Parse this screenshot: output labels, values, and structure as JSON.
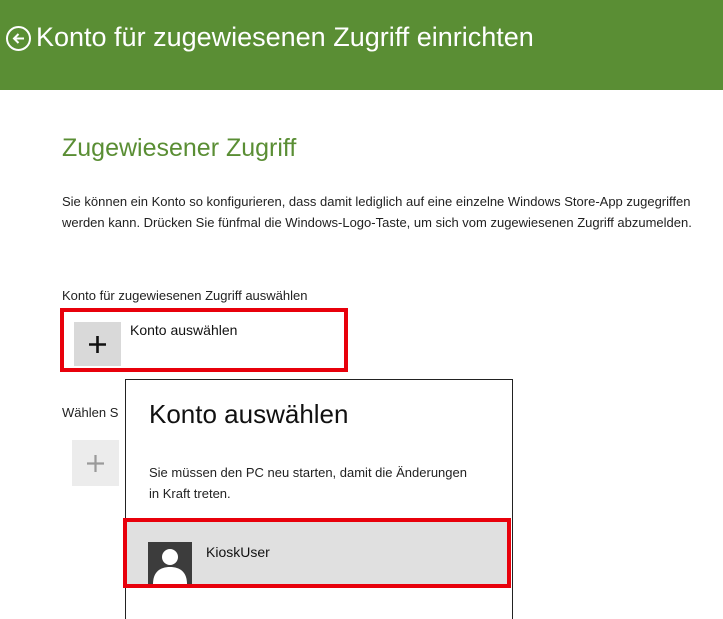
{
  "header": {
    "title": "Konto für zugewiesenen Zugriff einrichten",
    "back_icon": "back-arrow-circle-icon",
    "color": "#5a8e34"
  },
  "main": {
    "section_title": "Zugewiesener Zugriff",
    "description": "Sie können ein Konto so konfigurieren, dass damit lediglich auf eine einzelne Windows Store-App zugegriffen werden kann. Drücken Sie fünfmal die Windows-Logo-Taste, um sich vom zugewiesenen Zugriff abzumelden.",
    "account_section_label": "Konto für zugewiesenen Zugriff auswählen",
    "choose_account_label": "Konto auswählen",
    "app_section_label": "Wählen S",
    "highlight_color": "#e8000b"
  },
  "flyout": {
    "title": "Konto auswählen",
    "message": "Sie müssen den PC neu starten, damit die Änderungen in Kraft treten.",
    "users": [
      {
        "name": "KioskUser",
        "icon": "user-avatar-icon"
      }
    ]
  }
}
